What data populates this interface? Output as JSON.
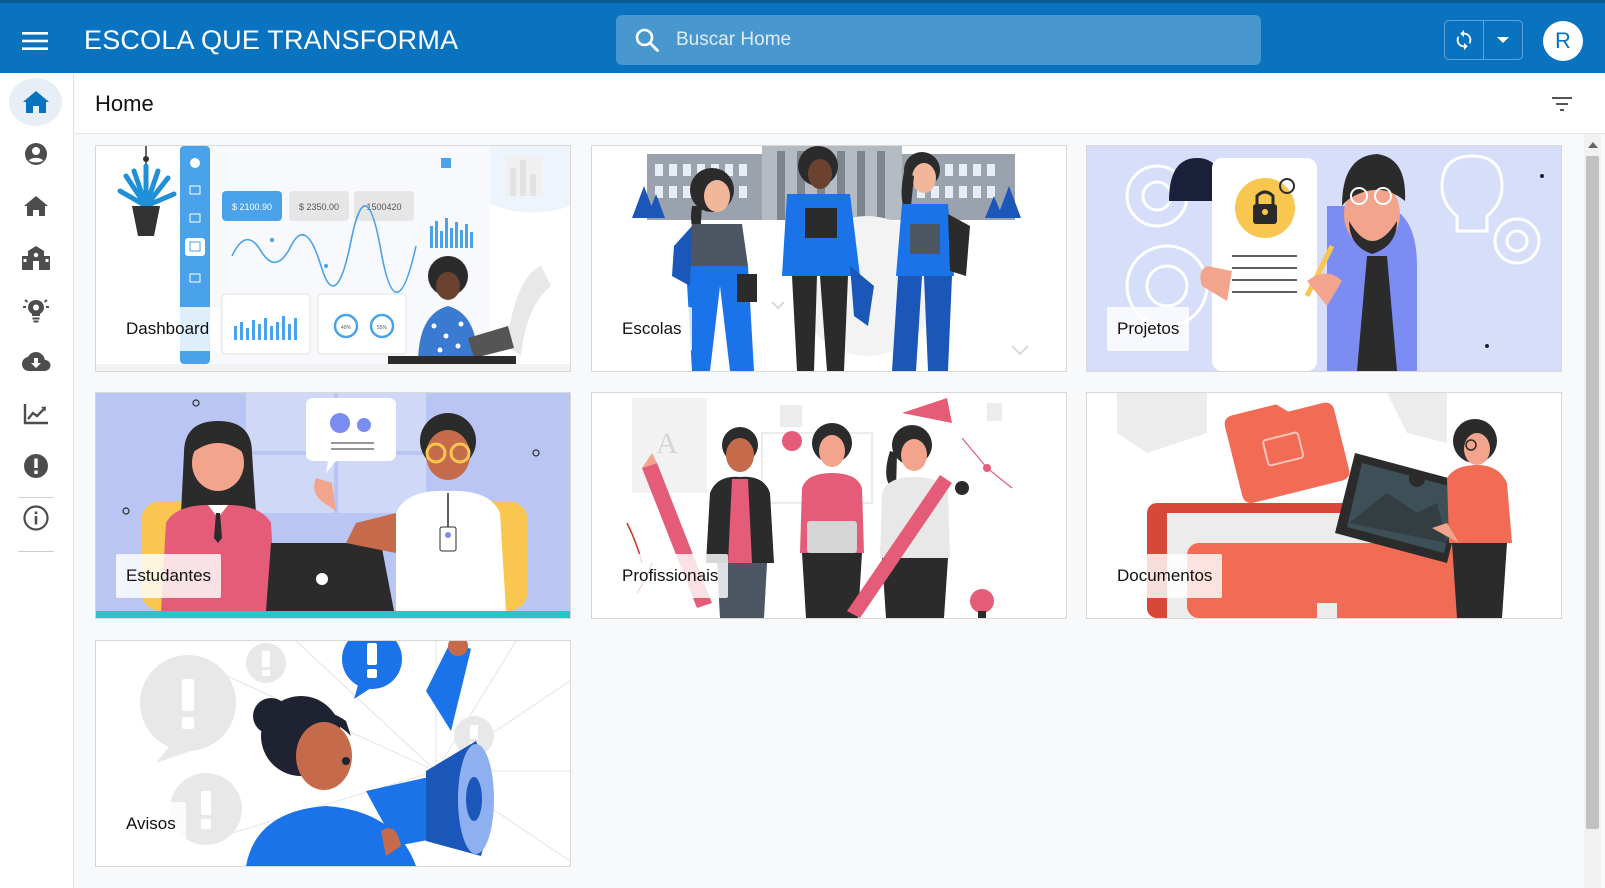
{
  "app": {
    "title": "ESCOLA QUE TRANSFORMA",
    "accent_color": "#0a73bf"
  },
  "search": {
    "placeholder": "Buscar Home",
    "value": ""
  },
  "user": {
    "initial": "R"
  },
  "sidebar": {
    "items": [
      {
        "name": "home",
        "icon": "home-icon",
        "active": true
      },
      {
        "name": "profile",
        "icon": "account-circle-icon"
      },
      {
        "name": "escolas",
        "icon": "house-icon"
      },
      {
        "name": "instituicoes",
        "icon": "building-group-icon"
      },
      {
        "name": "projetos",
        "icon": "lightbulb-gear-icon"
      },
      {
        "name": "downloads",
        "icon": "cloud-download-icon"
      },
      {
        "name": "relatorios",
        "icon": "trending-chart-icon"
      },
      {
        "name": "avisos",
        "icon": "alert-circle-icon"
      },
      {
        "name": "sobre",
        "icon": "info-icon"
      }
    ]
  },
  "page": {
    "title": "Home"
  },
  "cards": [
    {
      "label": "Dashboard",
      "dash_values": [
        "$ 2100.90",
        "$ 2350.00",
        "1500420"
      ],
      "donut_labels": [
        "40%",
        "55%"
      ]
    },
    {
      "label": "Escolas"
    },
    {
      "label": "Projetos"
    },
    {
      "label": "Estudantes"
    },
    {
      "label": "Profissionais"
    },
    {
      "label": "Documentos"
    },
    {
      "label": "Avisos"
    }
  ]
}
